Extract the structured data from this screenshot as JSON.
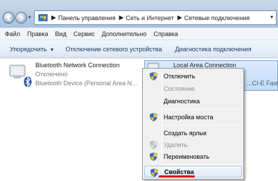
{
  "address": {
    "crumbs": [
      "Панель управления",
      "Сеть и Интернет",
      "Сетевые подключения"
    ]
  },
  "menubar": {
    "items": [
      "Файл",
      "Правка",
      "Вид",
      "Сервис",
      "Дополнительно",
      "Справка"
    ]
  },
  "cmdbar": {
    "organize": "Упорядочить",
    "disable": "Отключение сетевого устройства",
    "diagnose": "Диагностика подключения"
  },
  "connections": {
    "bluetooth": {
      "name": "Bluetooth Network Connection",
      "status": "Отключено",
      "device": "Bluetooth Device (Personal Area N..."
    },
    "lan": {
      "name": "Local Area Connection",
      "device": "...CI-E Fast ..."
    }
  },
  "context_menu": {
    "items": [
      {
        "label": "Отключить",
        "icon": "shield-icon",
        "state": "normal"
      },
      {
        "label": "Состояние",
        "icon": "",
        "state": "disabled"
      },
      {
        "label": "Диагностика",
        "icon": "",
        "state": "normal"
      },
      {
        "label": "Настройка моста",
        "icon": "shield-icon",
        "state": "normal"
      },
      {
        "label": "Создать ярлык",
        "icon": "",
        "state": "normal"
      },
      {
        "label": "Удалить",
        "icon": "shield-icon",
        "state": "disabled"
      },
      {
        "label": "Переименовать",
        "icon": "shield-icon",
        "state": "normal"
      },
      {
        "label": "Свойства",
        "icon": "shield-icon",
        "state": "selected"
      }
    ]
  },
  "colors": {
    "highlight_underline": "#d40000",
    "command_text": "#1e395b"
  }
}
